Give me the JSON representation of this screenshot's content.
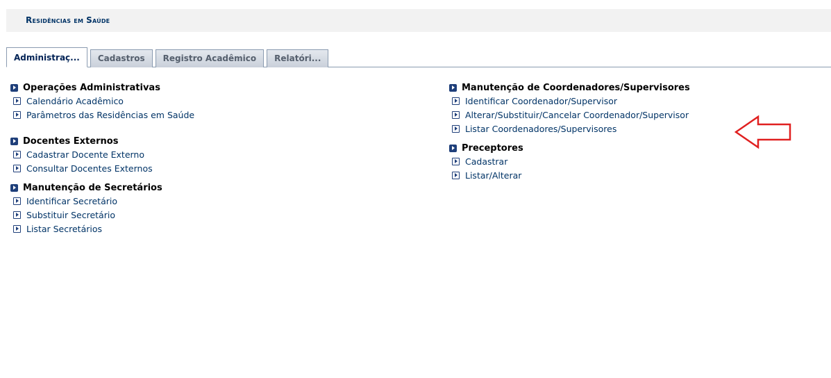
{
  "header": {
    "title_first": "R",
    "title_rest": "esidências em ",
    "title_s": "S",
    "title_end": "aúde"
  },
  "tabs": [
    {
      "label": "Administraç...",
      "active": true
    },
    {
      "label": "Cadastros",
      "active": false
    },
    {
      "label": "Registro Acadêmico",
      "active": false
    },
    {
      "label": "Relatóri...",
      "active": false
    }
  ],
  "left_column": {
    "sections": [
      {
        "title": "Operações Administrativas",
        "items": [
          "Calendário Acadêmico",
          "Parâmetros das Residências em Saúde"
        ]
      },
      {
        "title": "Docentes Externos",
        "items": [
          "Cadastrar Docente Externo",
          "Consultar Docentes Externos"
        ]
      },
      {
        "title": "Manutenção de Secretários",
        "items": [
          "Identificar Secretário",
          "Substituir Secretário",
          "Listar Secretários"
        ]
      }
    ]
  },
  "right_column": {
    "sections": [
      {
        "title": "Manutenção de Coordenadores/Supervisores",
        "items": [
          "Identificar Coordenador/Supervisor",
          "Alterar/Substituir/Cancelar Coordenador/Supervisor",
          "Listar Coordenadores/Supervisores"
        ]
      },
      {
        "title": "Preceptores",
        "items": [
          "Cadastrar",
          "Listar/Alterar"
        ]
      }
    ]
  },
  "annotation": {
    "arrow_color": "#e02020",
    "icon": "left-arrow-outline-icon"
  },
  "colors": {
    "link": "#003366",
    "icon": "#1f3f7a"
  }
}
